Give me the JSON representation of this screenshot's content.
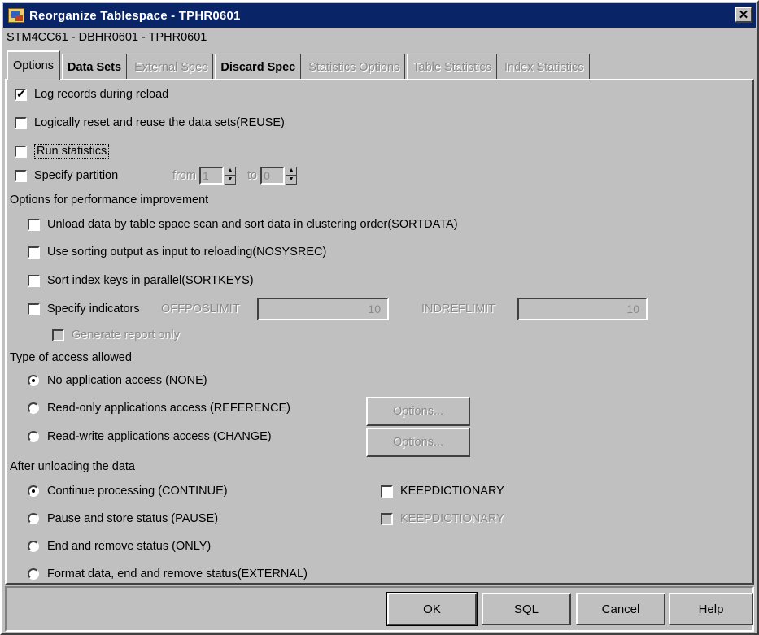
{
  "window": {
    "title": "Reorganize Tablespace - TPHR0601",
    "close_glyph": "✕",
    "subtitle": "STM4CC61 - DBHR0601 - TPHR0601"
  },
  "tabs": [
    {
      "label": "Options",
      "active": true,
      "enabled": true
    },
    {
      "label": "Data Sets",
      "enabled": true
    },
    {
      "label": "External Spec",
      "enabled": false
    },
    {
      "label": "Discard Spec",
      "enabled": true
    },
    {
      "label": "Statistics Options",
      "enabled": false
    },
    {
      "label": "Table Statistics",
      "enabled": false
    },
    {
      "label": "Index Statistics",
      "enabled": false
    }
  ],
  "options": {
    "log_records": {
      "label": "Log records during reload",
      "checked": true
    },
    "reuse": {
      "label": "Logically reset and reuse the data sets(REUSE)",
      "checked": false
    },
    "run_statistics": {
      "label": "Run statistics",
      "checked": false
    },
    "specify_partition": {
      "label": "Specify partition",
      "checked": false,
      "from_label": "from",
      "from_value": "1",
      "to_label": "to",
      "to_value": "0"
    }
  },
  "performance": {
    "heading": "Options for performance improvement",
    "sortdata": {
      "label": "Unload data by table space scan and sort data in clustering order(SORTDATA)",
      "checked": false
    },
    "nosysrec": {
      "label": "Use sorting output as input to reloading(NOSYSREC)",
      "checked": false
    },
    "sortkeys": {
      "label": "Sort index keys in parallel(SORTKEYS)",
      "checked": false
    },
    "indicators": {
      "label": "Specify indicators",
      "checked": false,
      "offposlimit_label": "OFFPOSLIMIT",
      "offposlimit_value": "10",
      "indreflimit_label": "INDREFLIMIT",
      "indreflimit_value": "10"
    },
    "report_only": {
      "label": "Generate report only",
      "checked": false
    }
  },
  "access": {
    "heading": "Type of access allowed",
    "none": {
      "label": "No application access (NONE)",
      "selected": true
    },
    "reference": {
      "label": "Read-only applications access (REFERENCE)",
      "selected": false,
      "button": "Options..."
    },
    "change": {
      "label": "Read-write applications access (CHANGE)",
      "selected": false,
      "button": "Options..."
    }
  },
  "unload": {
    "heading": "After unloading the data",
    "continue": {
      "label": "Continue processing (CONTINUE)",
      "selected": true
    },
    "pause": {
      "label": "Pause and store status (PAUSE)",
      "selected": false
    },
    "only": {
      "label": "End and remove status (ONLY)",
      "selected": false
    },
    "external": {
      "label": "Format data, end and remove status(EXTERNAL)",
      "selected": false
    },
    "keepdictionary_1": {
      "label": "KEEPDICTIONARY",
      "checked": false
    },
    "keepdictionary_2": {
      "label": "KEEPDICTIONARY",
      "checked": false
    }
  },
  "buttons": {
    "ok": "OK",
    "sql": "SQL",
    "cancel": "Cancel",
    "help": "Help"
  }
}
